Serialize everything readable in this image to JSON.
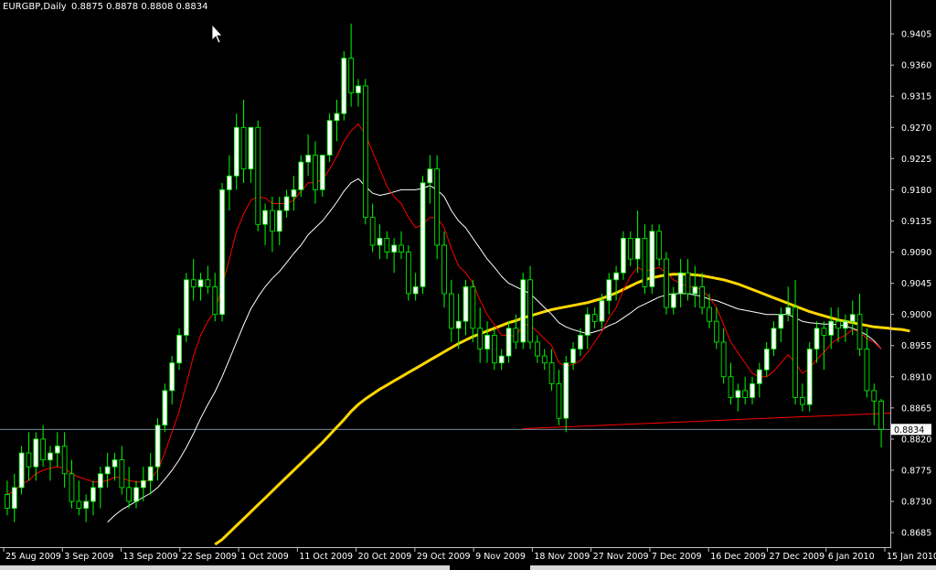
{
  "header": {
    "symbol_period": "EURGBP,Daily",
    "ohlc": "0.8875 0.8878 0.8808 0.8834"
  },
  "current_price_label": "0.8834",
  "colors": {
    "background": "#000000",
    "bull_candle": "#ffffff",
    "bear_candle": "#000000",
    "wick": "#00ff00",
    "ma_fast": "#ff0000",
    "ma_medium": "#ffffff",
    "ma_slow": "#ffd700",
    "trendline": "#ff0000",
    "price_line": "#8aa0b8",
    "axis_text": "#ffffff"
  },
  "chart_data": {
    "type": "candlestick",
    "title": "EURGBP,Daily",
    "ylim": [
      0.8664,
      0.9454
    ],
    "y_ticks": [
      "0.9405",
      "0.9360",
      "0.9315",
      "0.9270",
      "0.9225",
      "0.9180",
      "0.9135",
      "0.9090",
      "0.9045",
      "0.9000",
      "0.8955",
      "0.8910",
      "0.8865",
      "0.8820",
      "0.8775",
      "0.8730",
      "0.8685"
    ],
    "x_ticks": [
      "25 Aug 2009",
      "3 Sep 2009",
      "13 Sep 2009",
      "22 Sep 2009",
      "1 Oct 2009",
      "11 Oct 2009",
      "20 Oct 2009",
      "29 Oct 2009",
      "9 Nov 2009",
      "18 Nov 2009",
      "27 Nov 2009",
      "7 Dec 2009",
      "16 Dec 2009",
      "27 Dec 2009",
      "6 Jan 2010",
      "15 Jan 2010"
    ],
    "grid": false,
    "current_price": 0.8834,
    "candles": [
      [
        0.874,
        0.876,
        0.871,
        0.872
      ],
      [
        0.872,
        0.877,
        0.87,
        0.875
      ],
      [
        0.875,
        0.881,
        0.874,
        0.88
      ],
      [
        0.88,
        0.883,
        0.876,
        0.878
      ],
      [
        0.878,
        0.883,
        0.876,
        0.882
      ],
      [
        0.882,
        0.884,
        0.878,
        0.879
      ],
      [
        0.879,
        0.881,
        0.876,
        0.88
      ],
      [
        0.88,
        0.883,
        0.878,
        0.881
      ],
      [
        0.881,
        0.883,
        0.875,
        0.877
      ],
      [
        0.877,
        0.879,
        0.872,
        0.873
      ],
      [
        0.873,
        0.876,
        0.871,
        0.872
      ],
      [
        0.872,
        0.874,
        0.87,
        0.873
      ],
      [
        0.873,
        0.876,
        0.871,
        0.875
      ],
      [
        0.875,
        0.878,
        0.872,
        0.877
      ],
      [
        0.877,
        0.88,
        0.875,
        0.878
      ],
      [
        0.878,
        0.88,
        0.876,
        0.879
      ],
      [
        0.879,
        0.881,
        0.874,
        0.875
      ],
      [
        0.875,
        0.878,
        0.872,
        0.873
      ],
      [
        0.873,
        0.876,
        0.872,
        0.875
      ],
      [
        0.875,
        0.878,
        0.873,
        0.876
      ],
      [
        0.876,
        0.88,
        0.874,
        0.878
      ],
      [
        0.878,
        0.885,
        0.876,
        0.884
      ],
      [
        0.884,
        0.89,
        0.883,
        0.889
      ],
      [
        0.889,
        0.894,
        0.887,
        0.893
      ],
      [
        0.893,
        0.898,
        0.892,
        0.897
      ],
      [
        0.897,
        0.906,
        0.896,
        0.905
      ],
      [
        0.905,
        0.908,
        0.902,
        0.904
      ],
      [
        0.904,
        0.906,
        0.902,
        0.905
      ],
      [
        0.905,
        0.907,
        0.903,
        0.904
      ],
      [
        0.904,
        0.906,
        0.899,
        0.9
      ],
      [
        0.9,
        0.919,
        0.899,
        0.918
      ],
      [
        0.918,
        0.923,
        0.915,
        0.92
      ],
      [
        0.92,
        0.929,
        0.918,
        0.927
      ],
      [
        0.927,
        0.931,
        0.919,
        0.921
      ],
      [
        0.921,
        0.927,
        0.919,
        0.927
      ],
      [
        0.927,
        0.928,
        0.912,
        0.913
      ],
      [
        0.913,
        0.916,
        0.91,
        0.915
      ],
      [
        0.915,
        0.917,
        0.909,
        0.912
      ],
      [
        0.912,
        0.917,
        0.91,
        0.915
      ],
      [
        0.915,
        0.918,
        0.914,
        0.917
      ],
      [
        0.917,
        0.92,
        0.915,
        0.918
      ],
      [
        0.918,
        0.923,
        0.917,
        0.922
      ],
      [
        0.922,
        0.926,
        0.92,
        0.923
      ],
      [
        0.923,
        0.925,
        0.916,
        0.918
      ],
      [
        0.918,
        0.923,
        0.917,
        0.923
      ],
      [
        0.923,
        0.929,
        0.922,
        0.928
      ],
      [
        0.928,
        0.931,
        0.925,
        0.929
      ],
      [
        0.929,
        0.938,
        0.928,
        0.937
      ],
      [
        0.937,
        0.942,
        0.93,
        0.932
      ],
      [
        0.932,
        0.934,
        0.93,
        0.933
      ],
      [
        0.933,
        0.934,
        0.913,
        0.914
      ],
      [
        0.914,
        0.916,
        0.909,
        0.91
      ],
      [
        0.91,
        0.913,
        0.908,
        0.911
      ],
      [
        0.911,
        0.912,
        0.908,
        0.909
      ],
      [
        0.909,
        0.911,
        0.906,
        0.91
      ],
      [
        0.91,
        0.912,
        0.908,
        0.909
      ],
      [
        0.909,
        0.91,
        0.902,
        0.903
      ],
      [
        0.903,
        0.906,
        0.902,
        0.904
      ],
      [
        0.904,
        0.92,
        0.903,
        0.919
      ],
      [
        0.919,
        0.923,
        0.916,
        0.921
      ],
      [
        0.921,
        0.923,
        0.908,
        0.91
      ],
      [
        0.91,
        0.912,
        0.901,
        0.903
      ],
      [
        0.903,
        0.905,
        0.896,
        0.898
      ],
      [
        0.898,
        0.903,
        0.895,
        0.899
      ],
      [
        0.899,
        0.905,
        0.897,
        0.904
      ],
      [
        0.904,
        0.905,
        0.896,
        0.898
      ],
      [
        0.898,
        0.901,
        0.893,
        0.895
      ],
      [
        0.895,
        0.899,
        0.893,
        0.897
      ],
      [
        0.897,
        0.898,
        0.892,
        0.893
      ],
      [
        0.893,
        0.895,
        0.892,
        0.894
      ],
      [
        0.894,
        0.899,
        0.893,
        0.898
      ],
      [
        0.898,
        0.9,
        0.895,
        0.896
      ],
      [
        0.896,
        0.906,
        0.895,
        0.905
      ],
      [
        0.905,
        0.907,
        0.895,
        0.896
      ],
      [
        0.896,
        0.897,
        0.893,
        0.894
      ],
      [
        0.894,
        0.895,
        0.892,
        0.893
      ],
      [
        0.893,
        0.895,
        0.889,
        0.89
      ],
      [
        0.89,
        0.892,
        0.884,
        0.885
      ],
      [
        0.885,
        0.894,
        0.883,
        0.893
      ],
      [
        0.893,
        0.896,
        0.892,
        0.895
      ],
      [
        0.895,
        0.898,
        0.894,
        0.897
      ],
      [
        0.897,
        0.901,
        0.895,
        0.9
      ],
      [
        0.9,
        0.901,
        0.898,
        0.899
      ],
      [
        0.899,
        0.903,
        0.898,
        0.902
      ],
      [
        0.902,
        0.906,
        0.9,
        0.905
      ],
      [
        0.905,
        0.907,
        0.902,
        0.906
      ],
      [
        0.906,
        0.912,
        0.905,
        0.911
      ],
      [
        0.911,
        0.912,
        0.907,
        0.908
      ],
      [
        0.908,
        0.915,
        0.906,
        0.911
      ],
      [
        0.911,
        0.913,
        0.903,
        0.904
      ],
      [
        0.904,
        0.913,
        0.903,
        0.912
      ],
      [
        0.912,
        0.913,
        0.907,
        0.908
      ],
      [
        0.908,
        0.909,
        0.9,
        0.901
      ],
      [
        0.901,
        0.904,
        0.9,
        0.903
      ],
      [
        0.903,
        0.908,
        0.901,
        0.906
      ],
      [
        0.906,
        0.908,
        0.902,
        0.903
      ],
      [
        0.903,
        0.907,
        0.901,
        0.904
      ],
      [
        0.904,
        0.906,
        0.9,
        0.901
      ],
      [
        0.901,
        0.903,
        0.898,
        0.899
      ],
      [
        0.899,
        0.901,
        0.895,
        0.896
      ],
      [
        0.896,
        0.898,
        0.89,
        0.891
      ],
      [
        0.891,
        0.893,
        0.887,
        0.888
      ],
      [
        0.888,
        0.89,
        0.886,
        0.889
      ],
      [
        0.889,
        0.891,
        0.887,
        0.888
      ],
      [
        0.888,
        0.891,
        0.887,
        0.89
      ],
      [
        0.89,
        0.893,
        0.888,
        0.892
      ],
      [
        0.892,
        0.896,
        0.891,
        0.895
      ],
      [
        0.895,
        0.899,
        0.894,
        0.898
      ],
      [
        0.898,
        0.901,
        0.896,
        0.9
      ],
      [
        0.9,
        0.904,
        0.899,
        0.901
      ],
      [
        0.901,
        0.905,
        0.887,
        0.888
      ],
      [
        0.888,
        0.89,
        0.886,
        0.887
      ],
      [
        0.887,
        0.896,
        0.886,
        0.895
      ],
      [
        0.895,
        0.899,
        0.893,
        0.898
      ],
      [
        0.898,
        0.899,
        0.892,
        0.897
      ],
      [
        0.897,
        0.901,
        0.895,
        0.899
      ],
      [
        0.899,
        0.901,
        0.896,
        0.898
      ],
      [
        0.898,
        0.9,
        0.896,
        0.899
      ],
      [
        0.899,
        0.902,
        0.897,
        0.9
      ],
      [
        0.9,
        0.903,
        0.894,
        0.895
      ],
      [
        0.895,
        0.898,
        0.888,
        0.889
      ],
      [
        0.889,
        0.89,
        0.884,
        0.8875
      ],
      [
        0.8875,
        0.8878,
        0.8808,
        0.8834
      ]
    ],
    "ma_fast": [
      0.874,
      0.8745,
      0.8755,
      0.876,
      0.877,
      0.8775,
      0.8778,
      0.878,
      0.8778,
      0.877,
      0.8765,
      0.8762,
      0.8758,
      0.8758,
      0.876,
      0.8765,
      0.8764,
      0.876,
      0.8758,
      0.8758,
      0.8762,
      0.8775,
      0.88,
      0.883,
      0.886,
      0.89,
      0.894,
      0.897,
      0.899,
      0.9005,
      0.904,
      0.908,
      0.912,
      0.9145,
      0.9165,
      0.917,
      0.9168,
      0.916,
      0.916,
      0.916,
      0.9165,
      0.9178,
      0.919,
      0.919,
      0.9195,
      0.921,
      0.9228,
      0.925,
      0.9265,
      0.9275,
      0.926,
      0.9235,
      0.921,
      0.9185,
      0.917,
      0.916,
      0.914,
      0.9125,
      0.913,
      0.914,
      0.914,
      0.9125,
      0.9095,
      0.907,
      0.906,
      0.9045,
      0.902,
      0.9,
      0.8985,
      0.897,
      0.897,
      0.8968,
      0.8985,
      0.8985,
      0.8975,
      0.8965,
      0.8955,
      0.893,
      0.8925,
      0.8928,
      0.8933,
      0.8945,
      0.896,
      0.8975,
      0.8995,
      0.901,
      0.9035,
      0.9055,
      0.9068,
      0.9062,
      0.9065,
      0.9068,
      0.906,
      0.905,
      0.9045,
      0.904,
      0.904,
      0.9035,
      0.9025,
      0.901,
      0.8985,
      0.896,
      0.8945,
      0.893,
      0.8915,
      0.891,
      0.891,
      0.8918,
      0.893,
      0.8942,
      0.893,
      0.8915,
      0.8922,
      0.8935,
      0.8945,
      0.8958,
      0.8965,
      0.897,
      0.8978,
      0.8975,
      0.8965,
      0.896,
      0.895
    ],
    "ma_medium": [
      null,
      null,
      null,
      null,
      null,
      null,
      null,
      null,
      null,
      null,
      null,
      null,
      null,
      null,
      0.87,
      0.871,
      0.8718,
      0.8724,
      0.873,
      0.8736,
      0.8742,
      0.875,
      0.8762,
      0.8775,
      0.879,
      0.8808,
      0.8828,
      0.885,
      0.887,
      0.8888,
      0.891,
      0.8935,
      0.896,
      0.8985,
      0.9008,
      0.9025,
      0.904,
      0.9052,
      0.9062,
      0.9075,
      0.9088,
      0.91,
      0.9115,
      0.9125,
      0.9135,
      0.9148,
      0.9162,
      0.9178,
      0.919,
      0.9196,
      0.9185,
      0.9175,
      0.9172,
      0.9174,
      0.9177,
      0.918,
      0.918,
      0.918,
      0.9182,
      0.9186,
      0.918,
      0.917,
      0.915,
      0.9135,
      0.9125,
      0.911,
      0.9095,
      0.908,
      0.9068,
      0.9055,
      0.9045,
      0.904,
      0.9035,
      0.903,
      0.902,
      0.901,
      0.9,
      0.8988,
      0.8982,
      0.8978,
      0.8975,
      0.8972,
      0.8975,
      0.8978,
      0.8984,
      0.8988,
      0.8995,
      0.9002,
      0.901,
      0.9015,
      0.902,
      0.9025,
      0.9028,
      0.903,
      0.903,
      0.903,
      0.9028,
      0.9026,
      0.9022,
      0.902,
      0.9016,
      0.9012,
      0.9008,
      0.9006,
      0.9004,
      0.9002,
      0.9,
      0.9,
      0.9,
      0.9,
      0.8995,
      0.899,
      0.8988,
      0.8987,
      0.8986,
      0.8986,
      0.8985,
      0.8983,
      0.898,
      0.8976,
      0.897,
      0.8962,
      0.895
    ],
    "ma_slow": [
      null,
      null,
      null,
      null,
      null,
      null,
      null,
      null,
      null,
      null,
      null,
      null,
      null,
      null,
      null,
      null,
      null,
      null,
      null,
      null,
      null,
      null,
      null,
      null,
      null,
      null,
      null,
      null,
      null,
      0.8668,
      0.8675,
      0.8685,
      0.8695,
      0.8705,
      0.8715,
      0.8725,
      0.8735,
      0.8745,
      0.8755,
      0.8765,
      0.8775,
      0.8785,
      0.8795,
      0.8805,
      0.8815,
      0.8826,
      0.8837,
      0.8848,
      0.886,
      0.887,
      0.8878,
      0.8885,
      0.8892,
      0.8898,
      0.8904,
      0.891,
      0.8916,
      0.8922,
      0.8928,
      0.8934,
      0.894,
      0.8946,
      0.8952,
      0.8958,
      0.8963,
      0.8968,
      0.8972,
      0.8976,
      0.898,
      0.8984,
      0.8988,
      0.8991,
      0.8995,
      0.8998,
      0.9001,
      0.9004,
      0.9007,
      0.9009,
      0.9011,
      0.9013,
      0.9015,
      0.9017,
      0.902,
      0.9023,
      0.9027,
      0.9031,
      0.9036,
      0.9041,
      0.9046,
      0.905,
      0.9053,
      0.9055,
      0.9057,
      0.9058,
      0.9058,
      0.9058,
      0.9057,
      0.9056,
      0.9054,
      0.9052,
      0.905,
      0.9047,
      0.9044,
      0.904,
      0.9036,
      0.9032,
      0.9028,
      0.9024,
      0.902,
      0.9016,
      0.9012,
      0.9008,
      0.9004,
      0.9001,
      0.8998,
      0.8995,
      0.8992,
      0.899,
      0.8988,
      0.8986,
      0.8984,
      0.8982,
      0.8981,
      0.898,
      0.8979,
      0.8978,
      0.8976
    ],
    "trendline": {
      "x": [
        72,
        122
      ],
      "y": [
        0.8835,
        0.8857
      ]
    }
  }
}
